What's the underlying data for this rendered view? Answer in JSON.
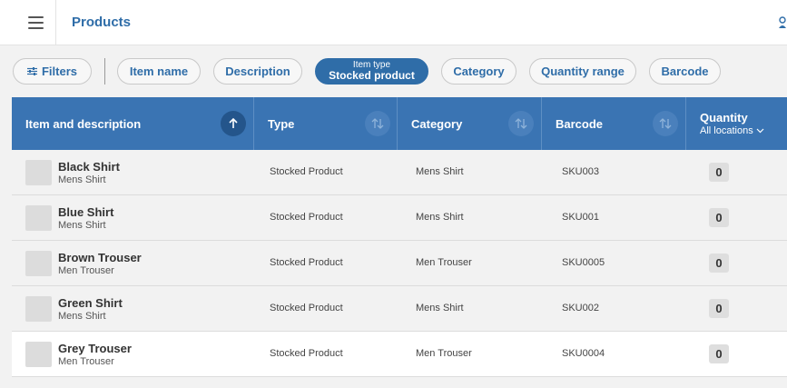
{
  "header": {
    "title": "Products",
    "menu_icon": "hamburger-menu-icon",
    "profile_icon": "user-icon"
  },
  "filters": {
    "filters_label": "Filters",
    "chips": [
      {
        "label": "Item name"
      },
      {
        "label": "Description"
      },
      {
        "label": "Item type",
        "value": "Stocked product",
        "active": true
      },
      {
        "label": "Category"
      },
      {
        "label": "Quantity range"
      },
      {
        "label": "Barcode"
      }
    ]
  },
  "table": {
    "columns": {
      "item": "Item and description",
      "type": "Type",
      "category": "Category",
      "barcode": "Barcode",
      "quantity": "Quantity",
      "quantity_sub": "All locations"
    },
    "rows": [
      {
        "name": "Black Shirt",
        "desc": "Mens Shirt",
        "type": "Stocked Product",
        "category": "Mens Shirt",
        "barcode": "SKU003",
        "qty": "0"
      },
      {
        "name": "Blue Shirt",
        "desc": "Mens Shirt",
        "type": "Stocked Product",
        "category": "Mens Shirt",
        "barcode": "SKU001",
        "qty": "0"
      },
      {
        "name": "Brown Trouser",
        "desc": "Men Trouser",
        "type": "Stocked Product",
        "category": "Men Trouser",
        "barcode": "SKU0005",
        "qty": "0"
      },
      {
        "name": "Green Shirt",
        "desc": "Mens Shirt",
        "type": "Stocked Product",
        "category": "Mens Shirt",
        "barcode": "SKU002",
        "qty": "0"
      },
      {
        "name": "Grey Trouser",
        "desc": "Men Trouser",
        "type": "Stocked Product",
        "category": "Men Trouser",
        "barcode": "SKU0004",
        "qty": "0"
      }
    ]
  },
  "colors": {
    "accent": "#2f6da8",
    "header_bg": "#3a74b3"
  }
}
